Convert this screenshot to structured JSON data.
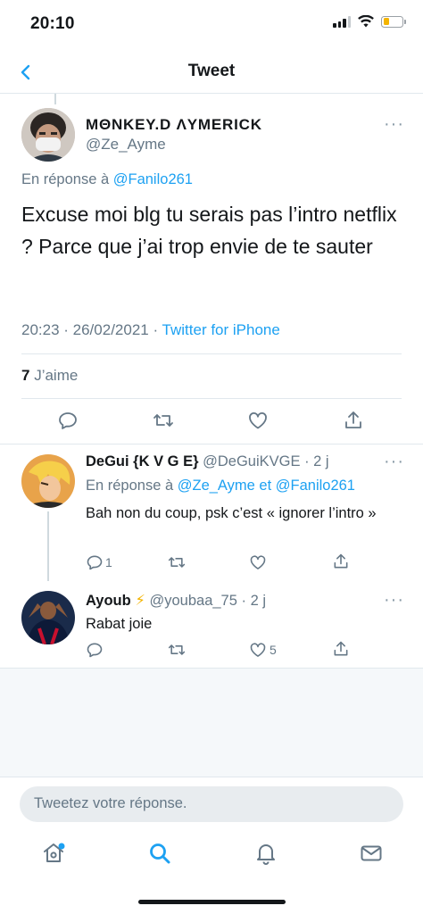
{
  "status_bar": {
    "time": "20:10"
  },
  "header": {
    "title": "Tweet"
  },
  "main_tweet": {
    "display_name": "MΘNKEY.D ΛYMERICK",
    "handle": "@Ze_Ayme",
    "reply_prefix": "En réponse à",
    "reply_to": "@Fanilo261",
    "text": "Excuse moi blg tu serais pas l’intro netflix ? Parce que j’ai trop envie de te sauter",
    "timestamp": "20:23 · 26/02/2021 ·",
    "source": "Twitter for iPhone",
    "likes_count": "7",
    "likes_label": "J’aime"
  },
  "replies": [
    {
      "display_name": "DeGui {K V G E}",
      "handle_time": "@DeGuiKVGE · 2 j",
      "reply_prefix": "En réponse à",
      "reply_to_1": "@Ze_Ayme",
      "reply_and": "et",
      "reply_to_2": "@Fanilo261",
      "text": "Bah non du coup, psk c’est « ignorer l’intro »",
      "reply_count": "1",
      "retweet_count": "",
      "like_count": ""
    },
    {
      "display_name": "Ayoub",
      "badge": "⚡",
      "handle_time": "@youbaa_75 · 2 j",
      "text": "Rabat joie",
      "reply_count": "",
      "retweet_count": "",
      "like_count": "5"
    }
  ],
  "compose": {
    "placeholder": "Tweetez votre réponse."
  },
  "tabbar": {
    "items": [
      "home-icon",
      "search-icon",
      "notifications-icon",
      "messages-icon"
    ],
    "active": "search-icon"
  },
  "colors": {
    "accent": "#1da1f2",
    "text": "#14171a",
    "secondary": "#657786",
    "border": "#e1e8ed",
    "battery": "#f4b400"
  }
}
